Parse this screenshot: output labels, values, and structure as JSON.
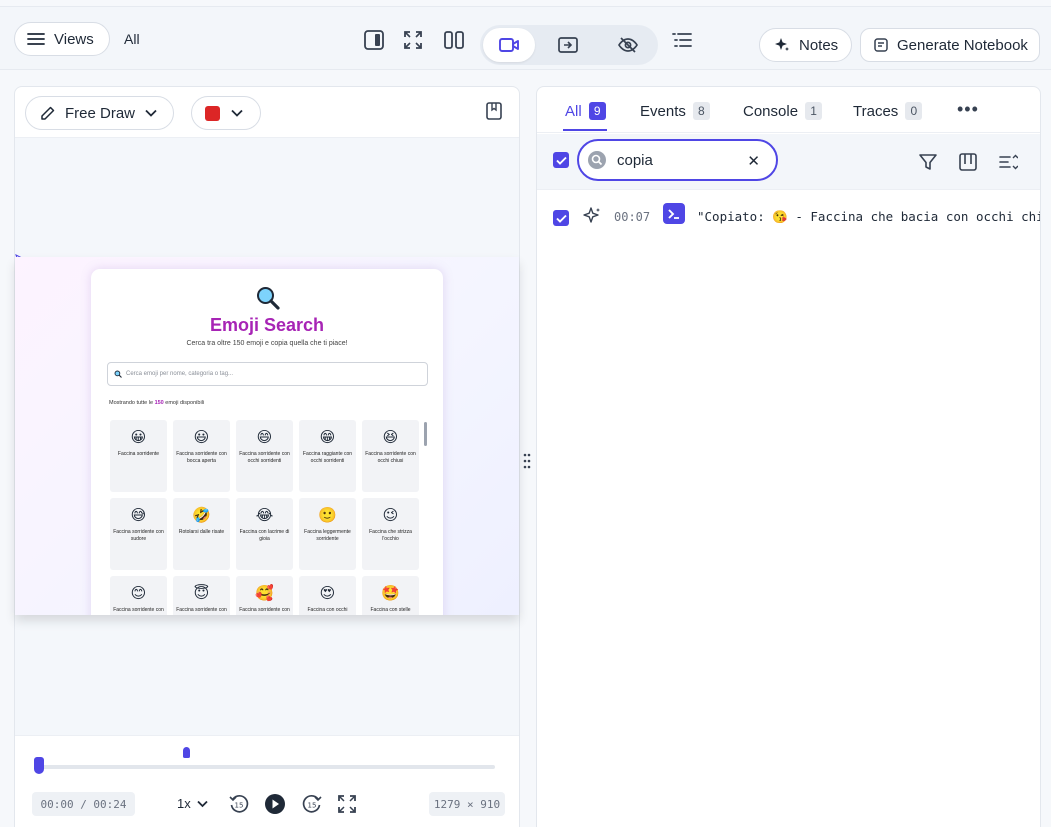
{
  "toolbar": {
    "views_label": "Views",
    "scope_label": "All",
    "notes_label": "Notes",
    "notebook_label": "Generate Notebook"
  },
  "player": {
    "tool_label": "Free Draw",
    "pen_color": "#dc2626",
    "time_display": "00:00 / 00:24",
    "speed": "1x",
    "dimensions": "1279 × 910",
    "progress_fraction": 0.0
  },
  "preview": {
    "title": "Emoji Search",
    "subtitle": "Cerca tra oltre 150 emoji e copia quella che ti piace!",
    "search_placeholder": "Cerca emoji per nome, categoria o tag...",
    "count_prefix": "Mostrando tutte le",
    "count_value": "150",
    "count_suffix": "emoji disponibili",
    "tiles": [
      {
        "emoji": "😀",
        "caption": "Faccina sorridente"
      },
      {
        "emoji": "😃",
        "caption": "Faccina sorridente con bocca aperta"
      },
      {
        "emoji": "😄",
        "caption": "Faccina sorridente con occhi sorridenti"
      },
      {
        "emoji": "😁",
        "caption": "Faccina raggiante con occhi sorridenti"
      },
      {
        "emoji": "😆",
        "caption": "Faccina sorridente con occhi chiusi"
      },
      {
        "emoji": "😅",
        "caption": "Faccina sorridente con sudore"
      },
      {
        "emoji": "🤣",
        "caption": "Rotolarsi dalle risate"
      },
      {
        "emoji": "😂",
        "caption": "Faccina con lacrime di gioia"
      },
      {
        "emoji": "🙂",
        "caption": "Faccina leggermente sorridente"
      },
      {
        "emoji": "😉",
        "caption": "Faccina che strizza l'occhio"
      },
      {
        "emoji": "😊",
        "caption": "Faccina sorridente con"
      },
      {
        "emoji": "😇",
        "caption": "Faccina sorridente con"
      },
      {
        "emoji": "🥰",
        "caption": "Faccina sorridente con"
      },
      {
        "emoji": "😍",
        "caption": "Faccina con occhi"
      },
      {
        "emoji": "🤩",
        "caption": "Faccina con stelle"
      }
    ]
  },
  "devtools": {
    "tabs": [
      {
        "label": "All",
        "count": "9"
      },
      {
        "label": "Events",
        "count": "8"
      },
      {
        "label": "Console",
        "count": "1"
      },
      {
        "label": "Traces",
        "count": "0"
      }
    ],
    "more_label": "•••",
    "search_value": "copia",
    "entries": [
      {
        "time": "00:07",
        "message": "\"Copiato: 😘 - Faccina che bacia con occhi chiusi\""
      }
    ]
  },
  "colors": {
    "accent": "#4f46e5",
    "brand_title": "#a724b5"
  }
}
